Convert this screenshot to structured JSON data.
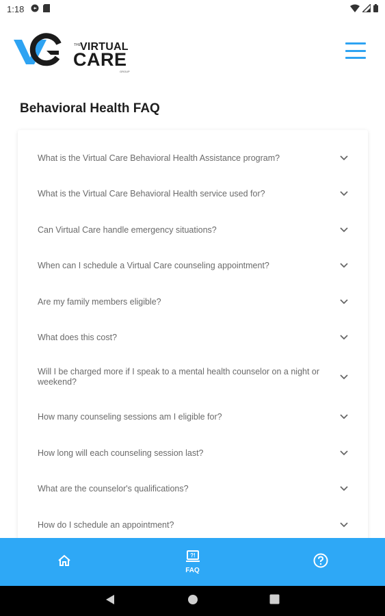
{
  "status_bar": {
    "time": "1:18",
    "icons": [
      "sync-icon",
      "sd-card-icon"
    ],
    "right_icons": [
      "wifi-icon",
      "signal-icon",
      "battery-icon"
    ]
  },
  "header": {
    "logo": {
      "small": "THE",
      "virtual": "VIRTUAL",
      "care": "CARE",
      "group": "GROUP"
    },
    "menu_icon": "hamburger-menu-icon",
    "accent_color": "#2ea3f2"
  },
  "page_title": "Behavioral Health FAQ",
  "faq": [
    {
      "question": "What is the Virtual Care Behavioral Health Assistance program?"
    },
    {
      "question": "What is the Virtual Care Behavioral Health service used for?"
    },
    {
      "question": "Can Virtual Care handle emergency situations?"
    },
    {
      "question": "When can I schedule a Virtual Care counseling appointment?"
    },
    {
      "question": "Are my family members eligible?"
    },
    {
      "question": "What does this cost?"
    },
    {
      "question": "Will I be charged more if I speak to a mental health counselor on a night or weekend?"
    },
    {
      "question": "How many counseling sessions am I eligible for?"
    },
    {
      "question": "How long will each counseling session last?"
    },
    {
      "question": "What are the counselor's qualifications?"
    },
    {
      "question": "How do I schedule an appointment?"
    }
  ],
  "bottom_nav": {
    "color": "#2ea8f6",
    "tabs": [
      {
        "icon": "home-icon",
        "label": ""
      },
      {
        "icon": "faq-icon",
        "label": "FAQ"
      },
      {
        "icon": "help-circle-icon",
        "label": ""
      }
    ]
  },
  "system_nav": [
    "back-icon",
    "home-circle-icon",
    "recents-icon"
  ]
}
